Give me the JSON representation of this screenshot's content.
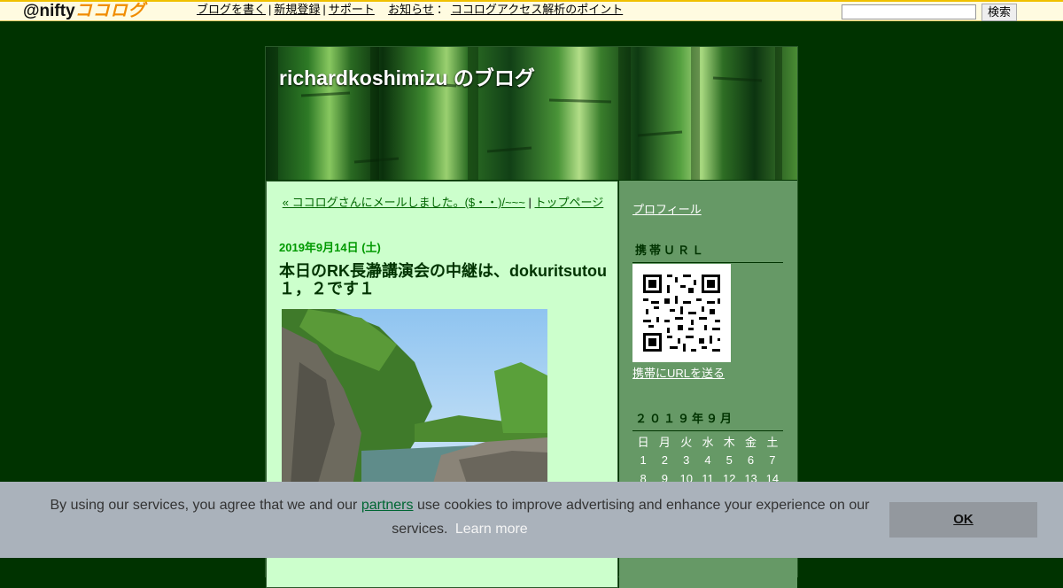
{
  "topbar": {
    "logo_prefix": "@nifty",
    "logo_brand": "ココログ",
    "links": [
      {
        "label": "ブログを書く"
      },
      {
        "label": "新規登録"
      },
      {
        "label": "サポート"
      },
      {
        "label": "お知らせ"
      },
      {
        "label": "ココログアクセス解析のポイント"
      }
    ],
    "search_value": "",
    "search_button": "検索"
  },
  "blog": {
    "title": "richardkoshimizu のブログ"
  },
  "post": {
    "prev_link": "« ココログさんにメールしました。($・・)/~~~",
    "nav_sep": "|",
    "top_link": "トップページ",
    "date": "2019年9月14日 (土)",
    "title": "本日のRK長瀞講演会の中継は、dokuritsutou１，２です１"
  },
  "sidebar": {
    "profile_link": "プロフィール",
    "mobile_heading": "携帯ＵＲＬ",
    "mobile_link": "携帯にURLを送る",
    "calendar_heading": "２０１９年９月",
    "weekdays": [
      "日",
      "月",
      "火",
      "水",
      "木",
      "金",
      "土"
    ],
    "rows": [
      [
        "1",
        "2",
        "3",
        "4",
        "5",
        "6",
        "7"
      ],
      [
        "8",
        "9",
        "10",
        "11",
        "12",
        "13",
        "14"
      ]
    ]
  },
  "cookie": {
    "text_before": "By using our services, you agree that we and our ",
    "partners": "partners",
    "text_after": " use cookies to improve advertising and enhance your experience on our services.",
    "learn_more": "Learn more",
    "ok": "OK"
  },
  "colors": {
    "page_bg": "#003300",
    "content_bg": "#ccffcc",
    "sidebar_bg": "#669966",
    "date_color": "#009900",
    "cookie_bg": "#aab2bb"
  }
}
